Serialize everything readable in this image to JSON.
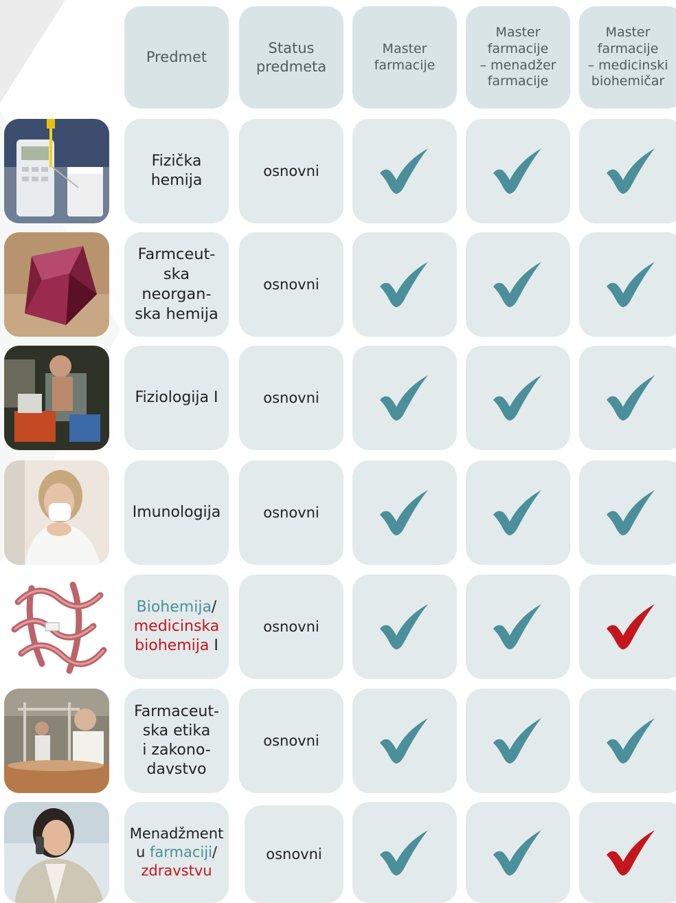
{
  "header": {
    "predmet": "Predmet",
    "status": [
      "Status",
      "predmeta"
    ],
    "master": [
      "Master",
      "farmacije"
    ],
    "master_menadzer": [
      "Master",
      "farmacije",
      "– menadžer",
      "farmacije"
    ],
    "master_biohemicar": [
      "Master",
      "farmacije",
      "– medicinski",
      "biohemičar"
    ]
  },
  "colors": {
    "check_teal": "#4b8f9a",
    "check_red": "#c4161c",
    "cell_bg": "#e3eaeb",
    "link_teal": "#4b8f9a",
    "link_red": "#c4161c"
  },
  "rows": [
    {
      "image": "thermometer-beaker-photo",
      "subject": [
        "Fizička",
        "hemija"
      ],
      "status": "osnovni",
      "checks": [
        "teal",
        "teal",
        "teal"
      ]
    },
    {
      "image": "red-crystal-photo",
      "subject": [
        "Farmceut-",
        "ska",
        "neorgan-",
        "ska hemija"
      ],
      "status": "osnovni",
      "checks": [
        "teal",
        "teal",
        "teal"
      ]
    },
    {
      "image": "physiology-test-photo",
      "subject": [
        "Fiziologija I"
      ],
      "status": "osnovni",
      "checks": [
        "teal",
        "teal",
        "teal"
      ]
    },
    {
      "image": "woman-sneezing-photo",
      "subject": [
        "Imunologija"
      ],
      "status": "osnovni",
      "checks": [
        "teal",
        "teal",
        "teal"
      ]
    },
    {
      "image": "protein-structure-illustration",
      "subject_parts": {
        "line1_a": "Biohemija",
        "line1_b": "/",
        "line2": "medicinska",
        "line3_a": "biohemija",
        "line3_b": " I"
      },
      "status": "osnovni",
      "checks": [
        "teal",
        "teal",
        "red"
      ]
    },
    {
      "image": "pharmacy-lab-photo",
      "subject": [
        "Farmaceut-",
        "ska etika",
        "i zakono-",
        "davstvo"
      ],
      "status": "osnovni",
      "checks": [
        "teal",
        "teal",
        "teal"
      ]
    },
    {
      "image": "woman-phone-photo",
      "subject_parts": {
        "line1": "Menadžment",
        "line2_a": "u ",
        "line2_b": "farmaciji",
        "line2_c": "/",
        "line3": "zdravstvu"
      },
      "status": "osnovni",
      "checks": [
        "teal",
        "teal",
        "red"
      ]
    }
  ]
}
